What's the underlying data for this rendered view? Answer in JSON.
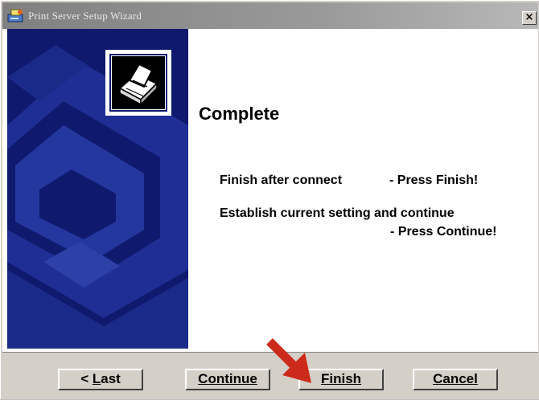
{
  "window": {
    "title": "Print Server Setup Wizard",
    "close_label": "×"
  },
  "content": {
    "heading": "Complete",
    "instruction_1_text": "Finish after connect",
    "instruction_1_action": "- Press Finish!",
    "instruction_2_text": "Establish current setting and continue",
    "instruction_2_action": "- Press Continue!"
  },
  "buttons": {
    "last": {
      "prefix": "< ",
      "accel": "L",
      "rest": "ast"
    },
    "continue": {
      "accel": "C",
      "rest": "ontinue"
    },
    "finish": {
      "accel": "F",
      "rest": "inish"
    },
    "cancel": {
      "accel": "C",
      "rest": "ancel"
    }
  },
  "colors": {
    "side_panel": "#0f1a6e",
    "pointer_arrow": "#cc2a1a",
    "title_bar": "#808080"
  },
  "icons": {
    "title": "printer-setup-icon",
    "logo": "printer-icon",
    "pointer": "red-arrow-pointer"
  }
}
